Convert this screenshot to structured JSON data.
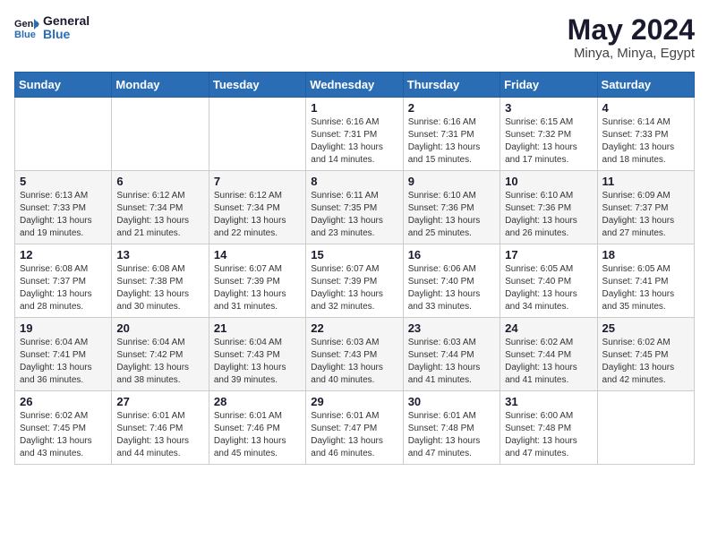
{
  "logo": {
    "line1": "General",
    "line2": "Blue"
  },
  "title": "May 2024",
  "location": "Minya, Minya, Egypt",
  "weekdays": [
    "Sunday",
    "Monday",
    "Tuesday",
    "Wednesday",
    "Thursday",
    "Friday",
    "Saturday"
  ],
  "weeks": [
    [
      {
        "day": "",
        "info": ""
      },
      {
        "day": "",
        "info": ""
      },
      {
        "day": "",
        "info": ""
      },
      {
        "day": "1",
        "info": "Sunrise: 6:16 AM\nSunset: 7:31 PM\nDaylight: 13 hours and 14 minutes."
      },
      {
        "day": "2",
        "info": "Sunrise: 6:16 AM\nSunset: 7:31 PM\nDaylight: 13 hours and 15 minutes."
      },
      {
        "day": "3",
        "info": "Sunrise: 6:15 AM\nSunset: 7:32 PM\nDaylight: 13 hours and 17 minutes."
      },
      {
        "day": "4",
        "info": "Sunrise: 6:14 AM\nSunset: 7:33 PM\nDaylight: 13 hours and 18 minutes."
      }
    ],
    [
      {
        "day": "5",
        "info": "Sunrise: 6:13 AM\nSunset: 7:33 PM\nDaylight: 13 hours and 19 minutes."
      },
      {
        "day": "6",
        "info": "Sunrise: 6:12 AM\nSunset: 7:34 PM\nDaylight: 13 hours and 21 minutes."
      },
      {
        "day": "7",
        "info": "Sunrise: 6:12 AM\nSunset: 7:34 PM\nDaylight: 13 hours and 22 minutes."
      },
      {
        "day": "8",
        "info": "Sunrise: 6:11 AM\nSunset: 7:35 PM\nDaylight: 13 hours and 23 minutes."
      },
      {
        "day": "9",
        "info": "Sunrise: 6:10 AM\nSunset: 7:36 PM\nDaylight: 13 hours and 25 minutes."
      },
      {
        "day": "10",
        "info": "Sunrise: 6:10 AM\nSunset: 7:36 PM\nDaylight: 13 hours and 26 minutes."
      },
      {
        "day": "11",
        "info": "Sunrise: 6:09 AM\nSunset: 7:37 PM\nDaylight: 13 hours and 27 minutes."
      }
    ],
    [
      {
        "day": "12",
        "info": "Sunrise: 6:08 AM\nSunset: 7:37 PM\nDaylight: 13 hours and 28 minutes."
      },
      {
        "day": "13",
        "info": "Sunrise: 6:08 AM\nSunset: 7:38 PM\nDaylight: 13 hours and 30 minutes."
      },
      {
        "day": "14",
        "info": "Sunrise: 6:07 AM\nSunset: 7:39 PM\nDaylight: 13 hours and 31 minutes."
      },
      {
        "day": "15",
        "info": "Sunrise: 6:07 AM\nSunset: 7:39 PM\nDaylight: 13 hours and 32 minutes."
      },
      {
        "day": "16",
        "info": "Sunrise: 6:06 AM\nSunset: 7:40 PM\nDaylight: 13 hours and 33 minutes."
      },
      {
        "day": "17",
        "info": "Sunrise: 6:05 AM\nSunset: 7:40 PM\nDaylight: 13 hours and 34 minutes."
      },
      {
        "day": "18",
        "info": "Sunrise: 6:05 AM\nSunset: 7:41 PM\nDaylight: 13 hours and 35 minutes."
      }
    ],
    [
      {
        "day": "19",
        "info": "Sunrise: 6:04 AM\nSunset: 7:41 PM\nDaylight: 13 hours and 36 minutes."
      },
      {
        "day": "20",
        "info": "Sunrise: 6:04 AM\nSunset: 7:42 PM\nDaylight: 13 hours and 38 minutes."
      },
      {
        "day": "21",
        "info": "Sunrise: 6:04 AM\nSunset: 7:43 PM\nDaylight: 13 hours and 39 minutes."
      },
      {
        "day": "22",
        "info": "Sunrise: 6:03 AM\nSunset: 7:43 PM\nDaylight: 13 hours and 40 minutes."
      },
      {
        "day": "23",
        "info": "Sunrise: 6:03 AM\nSunset: 7:44 PM\nDaylight: 13 hours and 41 minutes."
      },
      {
        "day": "24",
        "info": "Sunrise: 6:02 AM\nSunset: 7:44 PM\nDaylight: 13 hours and 41 minutes."
      },
      {
        "day": "25",
        "info": "Sunrise: 6:02 AM\nSunset: 7:45 PM\nDaylight: 13 hours and 42 minutes."
      }
    ],
    [
      {
        "day": "26",
        "info": "Sunrise: 6:02 AM\nSunset: 7:45 PM\nDaylight: 13 hours and 43 minutes."
      },
      {
        "day": "27",
        "info": "Sunrise: 6:01 AM\nSunset: 7:46 PM\nDaylight: 13 hours and 44 minutes."
      },
      {
        "day": "28",
        "info": "Sunrise: 6:01 AM\nSunset: 7:46 PM\nDaylight: 13 hours and 45 minutes."
      },
      {
        "day": "29",
        "info": "Sunrise: 6:01 AM\nSunset: 7:47 PM\nDaylight: 13 hours and 46 minutes."
      },
      {
        "day": "30",
        "info": "Sunrise: 6:01 AM\nSunset: 7:48 PM\nDaylight: 13 hours and 47 minutes."
      },
      {
        "day": "31",
        "info": "Sunrise: 6:00 AM\nSunset: 7:48 PM\nDaylight: 13 hours and 47 minutes."
      },
      {
        "day": "",
        "info": ""
      }
    ]
  ]
}
